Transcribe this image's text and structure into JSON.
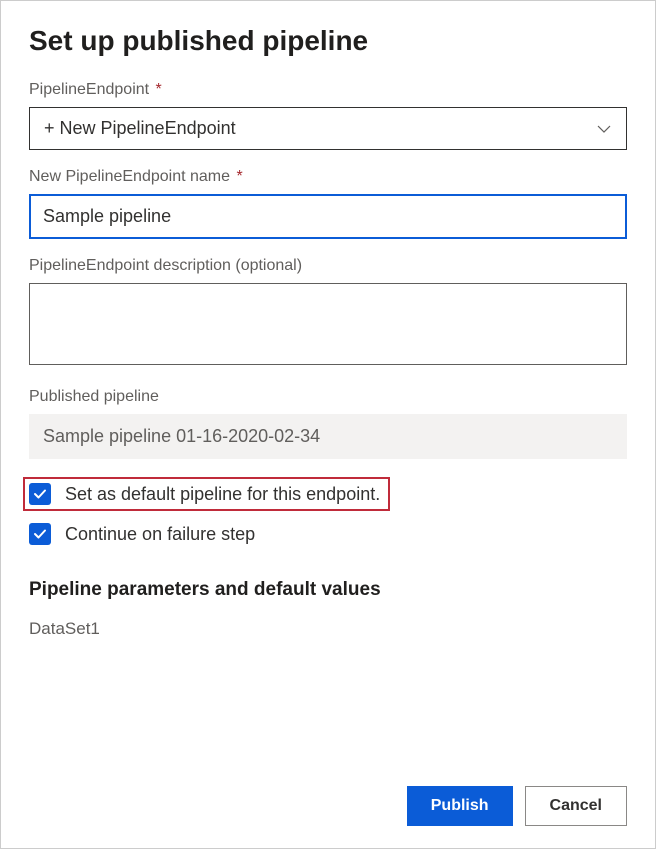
{
  "title": "Set up published pipeline",
  "fields": {
    "endpoint_label": "PipelineEndpoint",
    "endpoint_value": "+ New PipelineEndpoint",
    "endpoint_required": "*",
    "name_label": "New PipelineEndpoint name",
    "name_value": "Sample pipeline",
    "name_required": "*",
    "desc_label": "PipelineEndpoint description (optional)",
    "desc_value": "",
    "published_label": "Published pipeline",
    "published_value": "Sample pipeline 01-16-2020-02-34"
  },
  "checkboxes": {
    "default_label": "Set as default pipeline for this endpoint.",
    "default_checked": true,
    "continue_label": "Continue on failure step",
    "continue_checked": true
  },
  "params": {
    "heading": "Pipeline parameters and default values",
    "items": [
      "DataSet1"
    ]
  },
  "buttons": {
    "publish": "Publish",
    "cancel": "Cancel"
  }
}
